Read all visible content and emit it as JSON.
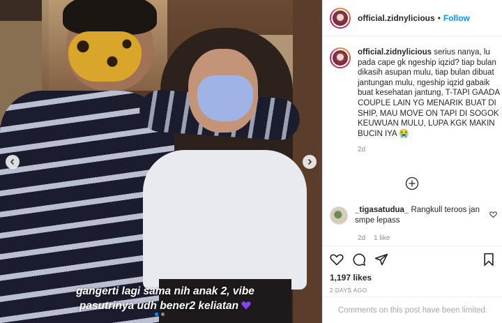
{
  "photo": {
    "caption_line1": "gangerti lagi sama nih anak 2, vibe",
    "caption_line2": "pasutrinya udh bener2 keliatan",
    "heart_emoji_color": "#8a3ffc",
    "carousel": {
      "total_slides": 2,
      "active_slide": 1
    },
    "prev_icon": "chevron-left-icon",
    "next_icon": "chevron-right-icon"
  },
  "header": {
    "username": "official.zidnylicious",
    "separator": "•",
    "follow_label": "Follow"
  },
  "caption": {
    "username": "official.zidnylicious",
    "text": "serius nanya, lu pada cape gk ngeship iqzid? tiap bulan dikasih asupan mulu, tiap bulan dibuat jantungan mulu, ngeship iqzid gabaik buat kesehatan jantung, T-TAPI GAADA COUPLE LAIN YG MENARIK BUAT DI SHIP, MAU MOVE ON TAPI DI SOGOK KEUWUAN MULU, LUPA KGK MAKIN BUCIN IYA 😭",
    "time": "2d"
  },
  "load_more_icon": "plus-circle-icon",
  "comments": [
    {
      "username": "_tigasatudua_",
      "text": "Rangkull teroos jan smpe lepass",
      "time": "2d",
      "likes": "1 like"
    }
  ],
  "actions": {
    "icons": [
      "heart-icon",
      "comment-icon",
      "share-icon",
      "bookmark-icon"
    ],
    "likes": "1,197 likes",
    "date": "2 DAYS AGO"
  },
  "comments_limited": "Comments on this post have been limited.",
  "colors": {
    "accent": "#0095f6",
    "text": "#262626",
    "muted": "#8e8e8e",
    "border": "#efefef"
  }
}
